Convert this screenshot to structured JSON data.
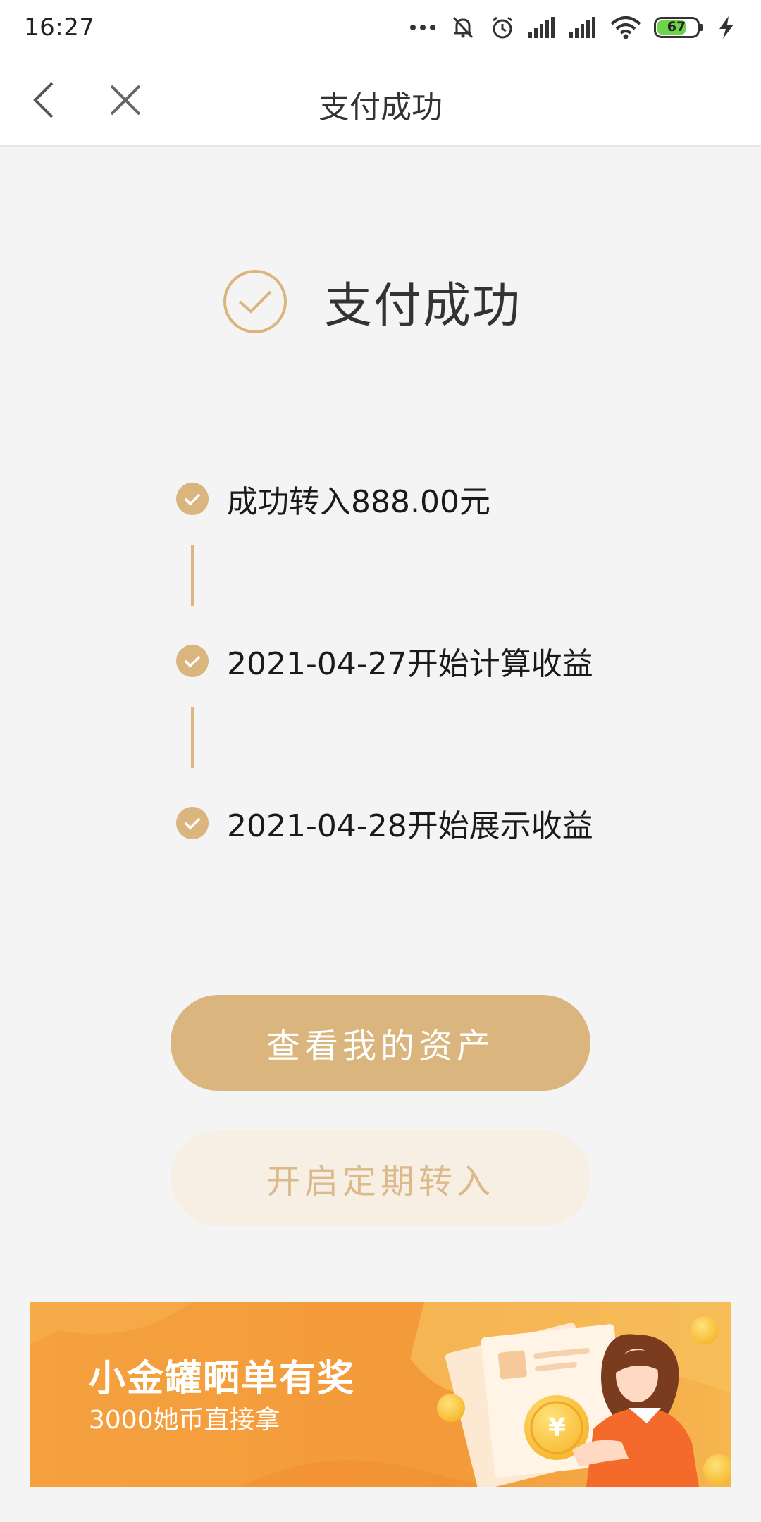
{
  "status_bar": {
    "time": "16:27",
    "battery": "67"
  },
  "navbar": {
    "title": "支付成功"
  },
  "result": {
    "title": "支付成功"
  },
  "steps": [
    {
      "text": "成功转入888.00元"
    },
    {
      "text": "2021-04-27开始计算收益"
    },
    {
      "text": "2021-04-28开始展示收益"
    }
  ],
  "buttons": {
    "view_assets": "查看我的资产",
    "auto_transfer": "开启定期转入"
  },
  "banner": {
    "title": "小金罐晒单有奖",
    "subtitle": "3000她币直接拿",
    "coin_symbol": "¥"
  },
  "colors": {
    "accent": "#dab57e",
    "secondary_bg": "#f8efe4",
    "banner_orange": "#f39a3a"
  }
}
